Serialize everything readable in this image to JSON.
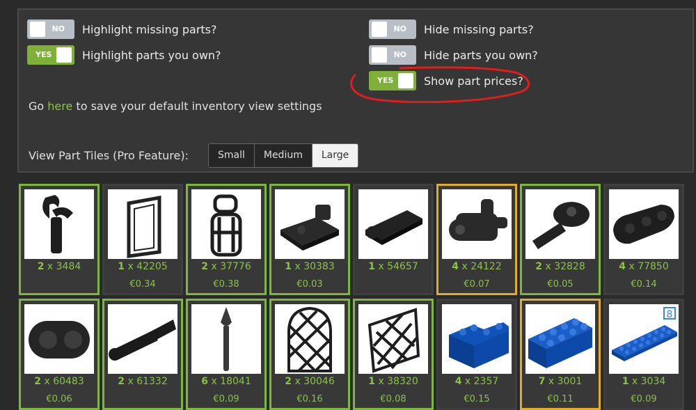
{
  "settings": {
    "highlight_missing": {
      "label": "Highlight missing parts?",
      "state": "NO"
    },
    "highlight_owned": {
      "label": "Highlight parts you own?",
      "state": "YES"
    },
    "hide_missing": {
      "label": "Hide missing parts?",
      "state": "NO"
    },
    "hide_owned": {
      "label": "Hide parts you own?",
      "state": "NO"
    },
    "show_prices": {
      "label": "Show part prices?",
      "state": "YES"
    },
    "go_prefix": "Go ",
    "go_link": "here",
    "go_suffix": " to save your default inventory view settings",
    "view_tiles_label": "View Part Tiles (Pro Feature):",
    "tile_sizes": [
      "Small",
      "Medium",
      "Large"
    ],
    "tile_size_selected": "Large"
  },
  "colors": {
    "accent_green": "#7cb83a",
    "owned_yellow": "#e1ad28",
    "toggle_off": "#b8bec5",
    "annotation_red": "#e01e1e"
  },
  "parts": [
    {
      "qty": "2",
      "x": " x ",
      "id": "3484",
      "price": "",
      "border": "green",
      "icon": "black-clip-arm-icon"
    },
    {
      "qty": "1",
      "x": " x ",
      "id": "42205",
      "price": "€0.34",
      "border": "none",
      "icon": "door-frame-icon"
    },
    {
      "qty": "2",
      "x": " x ",
      "id": "37776",
      "price": "€0.38",
      "border": "green",
      "icon": "lantern-cage-icon"
    },
    {
      "qty": "1",
      "x": " x ",
      "id": "30383",
      "price": "€0.03",
      "border": "green",
      "icon": "hinge-plate-icon"
    },
    {
      "qty": "1",
      "x": " x ",
      "id": "54657",
      "price": "",
      "border": "none",
      "icon": "clip-plate-icon"
    },
    {
      "qty": "4",
      "x": " x ",
      "id": "24122",
      "price": "€0.07",
      "border": "yellow",
      "icon": "pin-connector-icon"
    },
    {
      "qty": "2",
      "x": " x ",
      "id": "32828",
      "price": "€0.05",
      "border": "green",
      "icon": "tow-ball-icon"
    },
    {
      "qty": "4",
      "x": " x ",
      "id": "77850",
      "price": "€0.14",
      "border": "none",
      "icon": "rounded-plate-icon"
    },
    {
      "qty": "2",
      "x": " x ",
      "id": "60483",
      "price": "€0.06",
      "border": "green",
      "icon": "technic-link-icon"
    },
    {
      "qty": "2",
      "x": " x ",
      "id": "61332",
      "price": "",
      "border": "green",
      "icon": "technic-pin-icon"
    },
    {
      "qty": "6",
      "x": " x ",
      "id": "18041",
      "price": "€0.09",
      "border": "green",
      "icon": "spear-icon"
    },
    {
      "qty": "2",
      "x": " x ",
      "id": "30046",
      "price": "€0.16",
      "border": "green",
      "icon": "lattice-window-icon"
    },
    {
      "qty": "1",
      "x": " x ",
      "id": "38320",
      "price": "€0.08",
      "border": "green",
      "icon": "lattice-diamond-icon"
    },
    {
      "qty": "4",
      "x": " x ",
      "id": "2357",
      "price": "€0.15",
      "border": "none",
      "icon": "blue-corner-brick-icon"
    },
    {
      "qty": "7",
      "x": " x ",
      "id": "3001",
      "price": "€0.11",
      "border": "yellow",
      "icon": "blue-brick-2x4-icon"
    },
    {
      "qty": "1",
      "x": " x ",
      "id": "3034",
      "price": "€0.09",
      "border": "none",
      "icon": "blue-plate-2x8-icon",
      "badge": "8"
    }
  ]
}
